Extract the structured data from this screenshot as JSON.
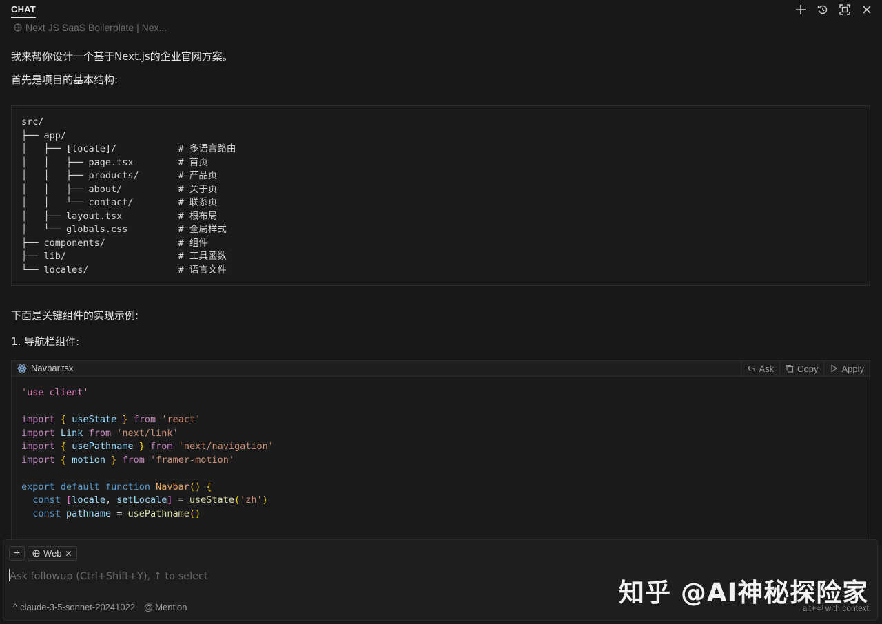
{
  "header": {
    "title": "CHAT",
    "actions": [
      "new-chat",
      "history",
      "maximize",
      "close"
    ]
  },
  "context": {
    "label": "Next JS SaaS Boilerplate | Nex..."
  },
  "messages": {
    "intro": "我来帮你设计一个基于Next.js的企业官网方案。",
    "structure_heading": "首先是项目的基本结构:",
    "components_heading": "下面是关键组件的实现示例:",
    "navbar_heading": "1. 导航栏组件:"
  },
  "file_tree": [
    {
      "path": "src/",
      "comment": ""
    },
    {
      "path": "├── app/",
      "comment": ""
    },
    {
      "path": "│   ├── [locale]/",
      "comment": "# 多语言路由"
    },
    {
      "path": "│   │   ├── page.tsx",
      "comment": "# 首页"
    },
    {
      "path": "│   │   ├── products/",
      "comment": "# 产品页"
    },
    {
      "path": "│   │   ├── about/",
      "comment": "# 关于页"
    },
    {
      "path": "│   │   └── contact/",
      "comment": "# 联系页"
    },
    {
      "path": "│   ├── layout.tsx",
      "comment": "# 根布局"
    },
    {
      "path": "│   └── globals.css",
      "comment": "# 全局样式"
    },
    {
      "path": "├── components/",
      "comment": "# 组件"
    },
    {
      "path": "├── lib/",
      "comment": "# 工具函数"
    },
    {
      "path": "└── locales/",
      "comment": "# 语言文件"
    }
  ],
  "code_block": {
    "filename": "Navbar.tsx",
    "ask_label": "Ask",
    "copy_label": "Copy",
    "apply_label": "Apply",
    "lines": [
      "'use client'",
      "",
      "import { useState } from 'react'",
      "import Link from 'next/link'",
      "import { usePathname } from 'next/navigation'",
      "import { motion } from 'framer-motion'",
      "",
      "export default function Navbar() {",
      "  const [locale, setLocale] = useState('zh')",
      "  const pathname = usePathname()"
    ]
  },
  "composer": {
    "add_label": "+",
    "web_chip": "Web",
    "placeholder": "Ask followup (Ctrl+Shift+Y), ↑ to select",
    "model": "claude-3-5-sonnet-20241022",
    "mention": "Mention",
    "hint": "alt+⏎ with context"
  },
  "watermark": "知乎 @AI神秘探险家",
  "colors": {
    "background": "#181818",
    "string": "#ce9178",
    "keyword": "#c586c0",
    "identifier": "#9cdcfe",
    "function": "#dcdcaa"
  }
}
